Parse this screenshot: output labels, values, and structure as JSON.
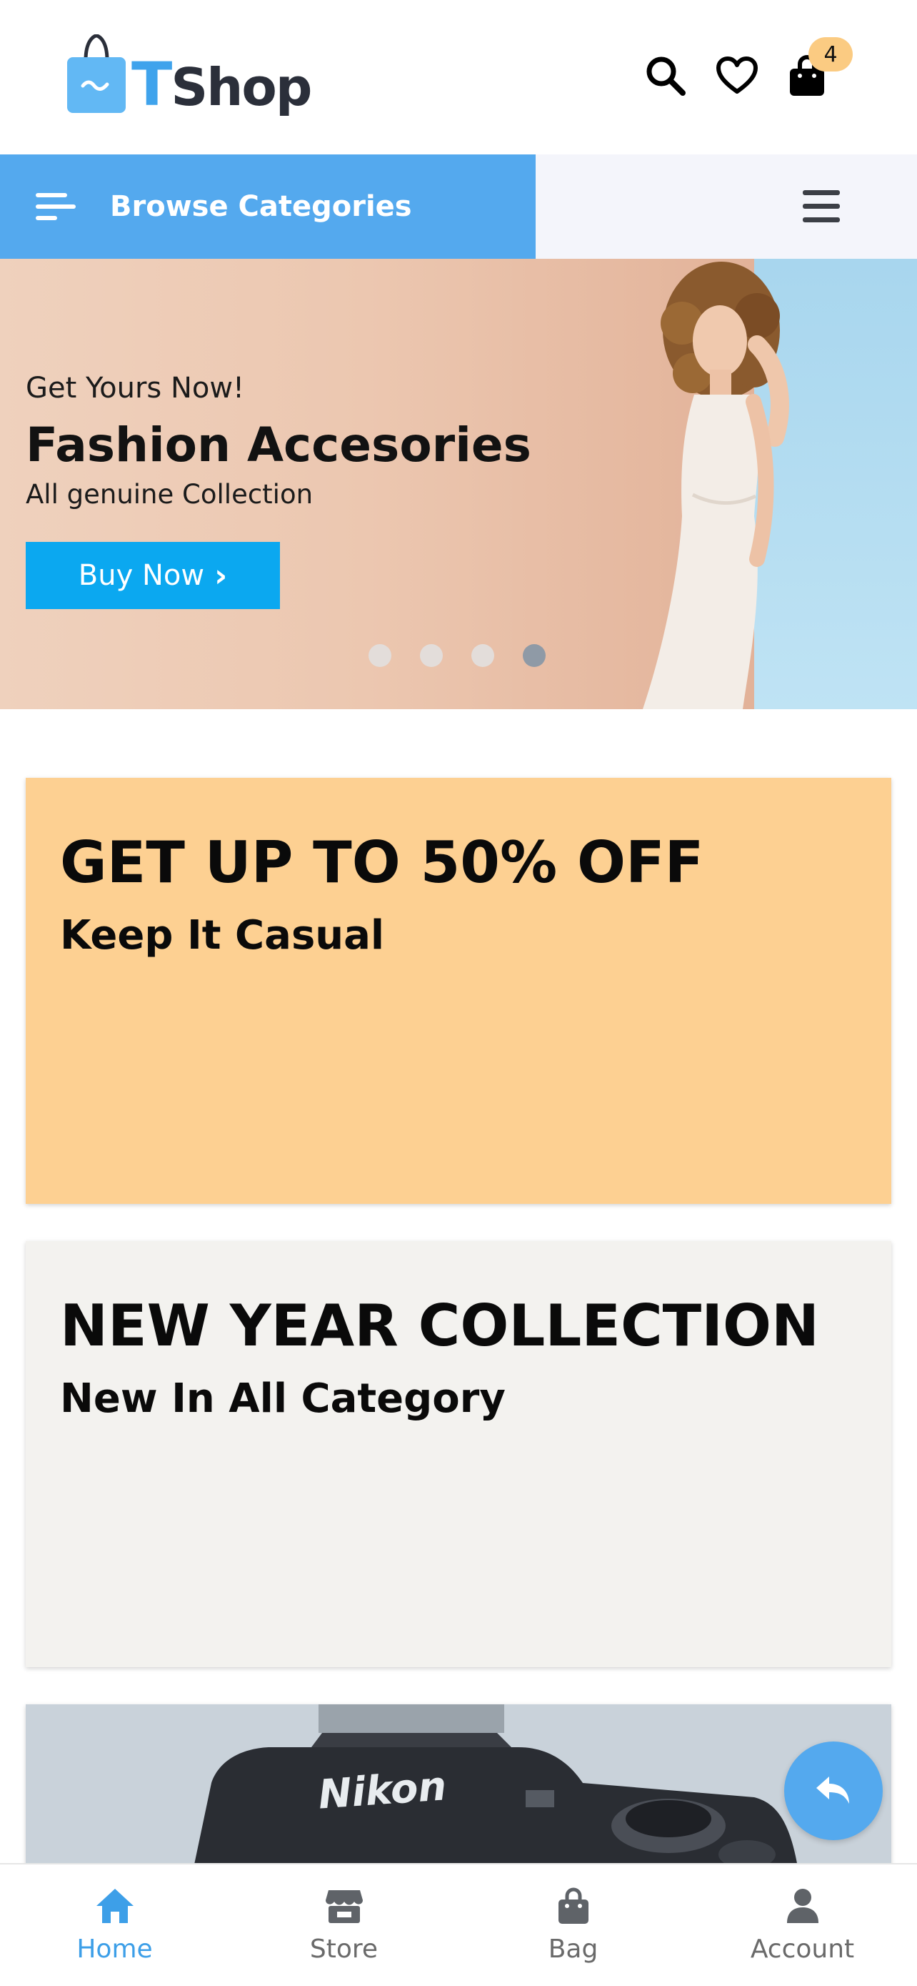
{
  "app": {
    "logo_t": "T",
    "logo_shop": "Shop"
  },
  "header": {
    "icons": [
      "search-icon",
      "heart-icon",
      "bag-icon"
    ],
    "cart_count": "4"
  },
  "category_bar": {
    "browse_label": "Browse Categories"
  },
  "hero": {
    "kicker": "Get Yours Now!",
    "title": "Fashion Accesories",
    "subtitle": "All genuine Collection",
    "button_label": "Buy Now",
    "slides_total": 4,
    "active_slide": 4
  },
  "promos": [
    {
      "title": "GET UP TO 50% OFF",
      "subtitle": "Keep It Casual",
      "bg": "#fdd092"
    },
    {
      "title": "NEW YEAR COLLECTION",
      "subtitle": "New In All Category",
      "bg": "#f3f2ef"
    },
    {
      "brand_text": "Nikon"
    }
  ],
  "bottom_nav": {
    "items": [
      {
        "label": "Home",
        "icon": "home-icon",
        "active": true
      },
      {
        "label": "Store",
        "icon": "store-icon",
        "active": false
      },
      {
        "label": "Bag",
        "icon": "bag-icon",
        "active": false
      },
      {
        "label": "Account",
        "icon": "user-icon",
        "active": false
      }
    ]
  },
  "colors": {
    "accent": "#54a9ee",
    "button": "#0ba8f0",
    "badge": "#fbcb82",
    "nav_active": "#3d9fe8"
  }
}
